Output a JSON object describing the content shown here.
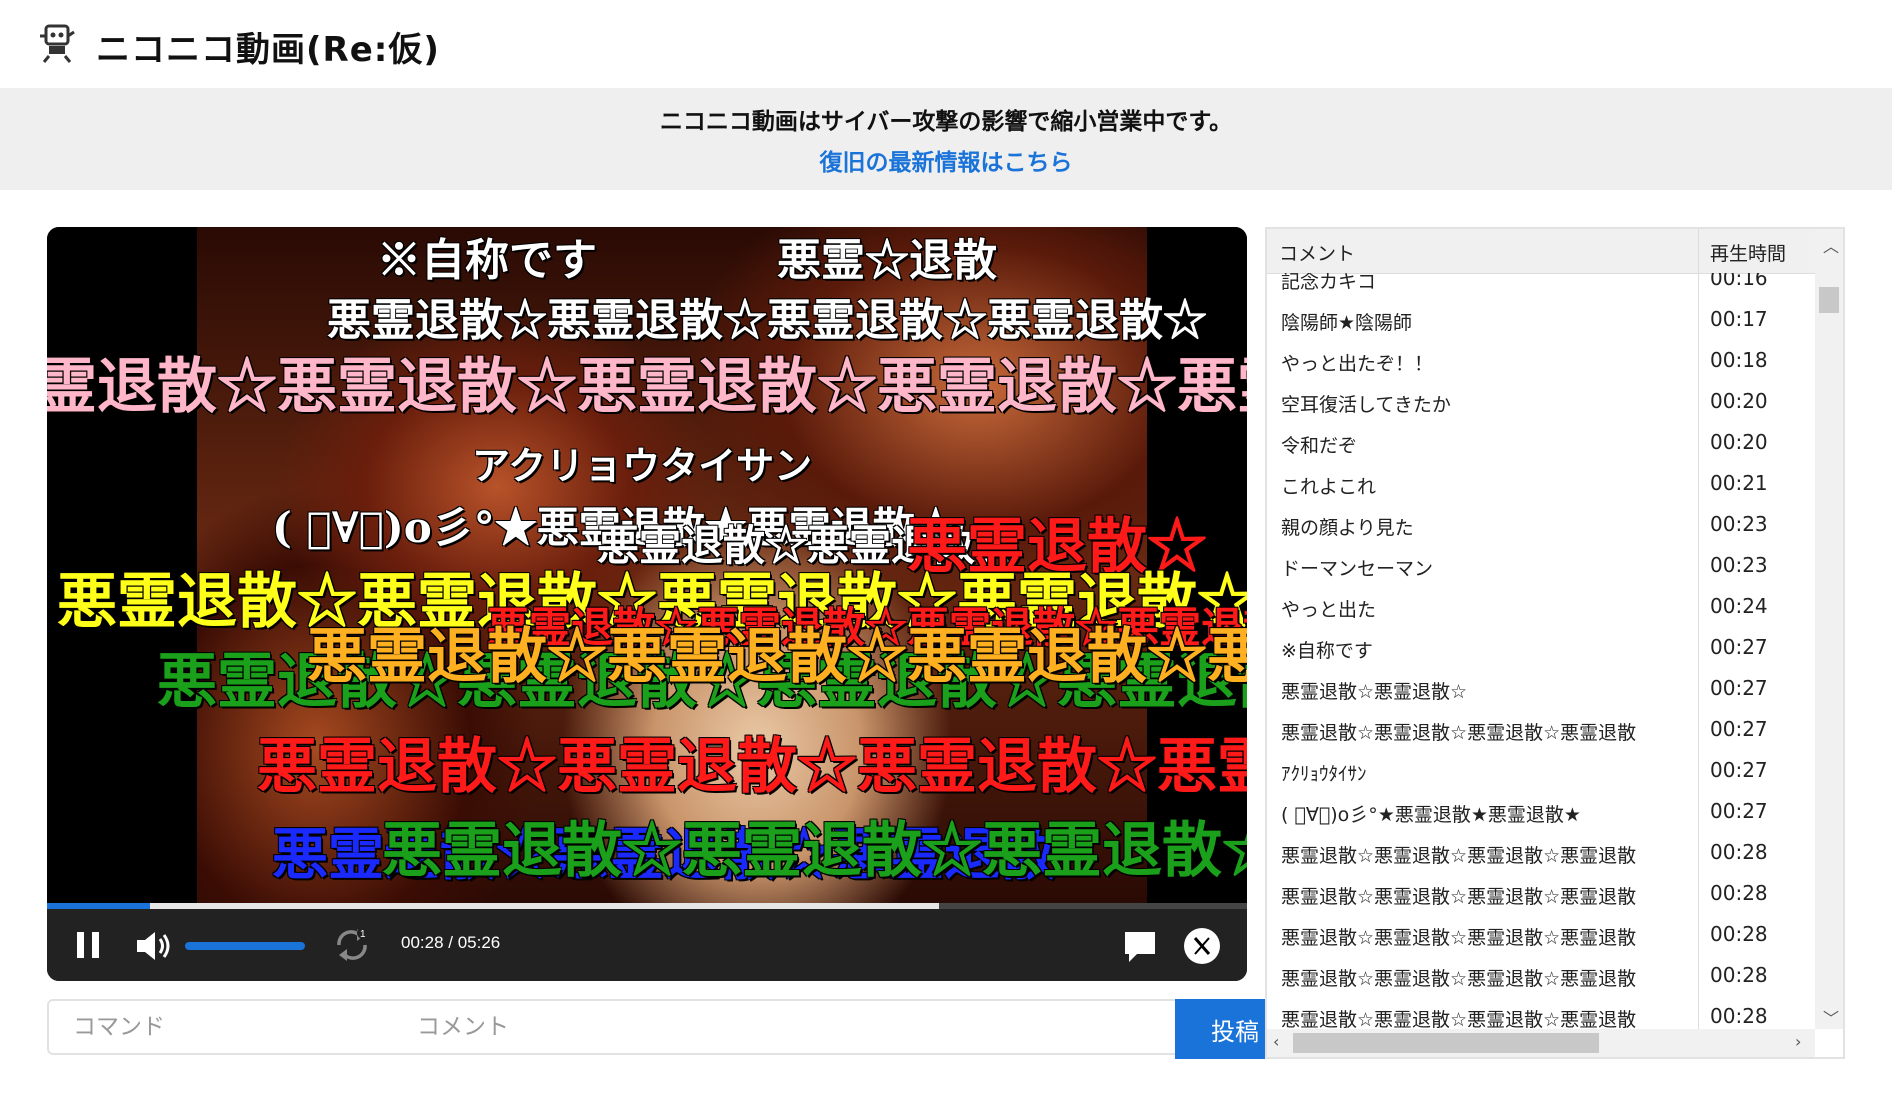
{
  "site": {
    "logo_text": "ニコニコ動画(Re:仮)"
  },
  "banner": {
    "message": "ニコニコ動画はサイバー攻撃の影響で縮小営業中です。",
    "link": "復旧の最新情報はこちら"
  },
  "player": {
    "progress": 0.0859,
    "buffered": 0.743,
    "volume": 0.9,
    "time_display": "00:28 / 05:26",
    "danmaku": [
      {
        "text": "※自称です",
        "color": "#ffffff"
      },
      {
        "text": "悪霊☆退散",
        "color": "#ffffff"
      },
      {
        "text": "悪霊退散☆悪霊退散☆悪霊退散☆悪霊退散☆",
        "color": "#ffffff"
      },
      {
        "text": "霊退散☆悪霊退散☆悪霊退散☆悪霊退散☆悪霊退散",
        "color": "#ffb6c8"
      },
      {
        "text": "アクリョウタイサン",
        "color": "#ffffff"
      },
      {
        "text": "( ﾟ∀ﾟ)o彡°★悪霊退散★悪霊退散★",
        "color": "#ffffff"
      },
      {
        "text": "悪霊退散☆悪霊退散☆",
        "color": "#ffffff"
      },
      {
        "text": "悪霊退散☆",
        "color": "#ff1a1a"
      },
      {
        "text": "悪霊退散☆悪霊退散☆悪霊退散☆悪霊退散☆",
        "color": "#ffff1a"
      },
      {
        "text": "悪霊退散☆悪霊退散☆悪霊退散☆悪霊退散",
        "color": "#ff1a1a"
      },
      {
        "text": "悪霊退散☆悪霊退散☆悪霊退散☆悪霊退散☆",
        "color": "#1aa01a"
      },
      {
        "text": "悪霊退散☆悪霊退散☆悪霊退散☆悪霊退散",
        "color": "#ffb020"
      },
      {
        "text": "悪霊退散☆悪霊退散☆悪霊退散☆悪霊退散☆",
        "color": "#ff1a1a"
      },
      {
        "text": "悪霊退散☆悪霊退散☆悪霊退散",
        "color": "#1a2aff"
      },
      {
        "text": "悪霊退散☆悪霊退散☆悪霊退散☆悪霊退散☆",
        "color": "#1aa01a"
      }
    ]
  },
  "inputs": {
    "command_placeholder": "コマンド",
    "comment_placeholder": "コメント",
    "post_label": "投稿"
  },
  "comments": {
    "header_comment": "コメント",
    "header_time": "再生時間",
    "rows": [
      {
        "text": "記念カキコ",
        "time": "00:16"
      },
      {
        "text": "陰陽師★陰陽師",
        "time": "00:17"
      },
      {
        "text": "やっと出たぞ！！",
        "time": "00:18"
      },
      {
        "text": "空耳復活してきたか",
        "time": "00:20"
      },
      {
        "text": "令和だぞ",
        "time": "00:20"
      },
      {
        "text": "これよこれ",
        "time": "00:21"
      },
      {
        "text": "親の顔より見た",
        "time": "00:23"
      },
      {
        "text": "ドーマンセーマン",
        "time": "00:23"
      },
      {
        "text": "やっと出た",
        "time": "00:24"
      },
      {
        "text": "※自称です",
        "time": "00:27"
      },
      {
        "text": "悪霊退散☆悪霊退散☆",
        "time": "00:27"
      },
      {
        "text": "悪霊退散☆悪霊退散☆悪霊退散☆悪霊退散",
        "time": "00:27"
      },
      {
        "text": "ｱｸﾘｮｳﾀｲｻﾝ",
        "time": "00:27"
      },
      {
        "text": "( ﾟ∀ﾟ)o彡°★悪霊退散★悪霊退散★",
        "time": "00:27"
      },
      {
        "text": "悪霊退散☆悪霊退散☆悪霊退散☆悪霊退散",
        "time": "00:28"
      },
      {
        "text": "悪霊退散☆悪霊退散☆悪霊退散☆悪霊退散",
        "time": "00:28"
      },
      {
        "text": "悪霊退散☆悪霊退散☆悪霊退散☆悪霊退散",
        "time": "00:28"
      },
      {
        "text": "悪霊退散☆悪霊退散☆悪霊退散☆悪霊退散",
        "time": "00:28"
      },
      {
        "text": "悪霊退散☆悪霊退散☆悪霊退散☆悪霊退散",
        "time": "00:28"
      }
    ]
  }
}
